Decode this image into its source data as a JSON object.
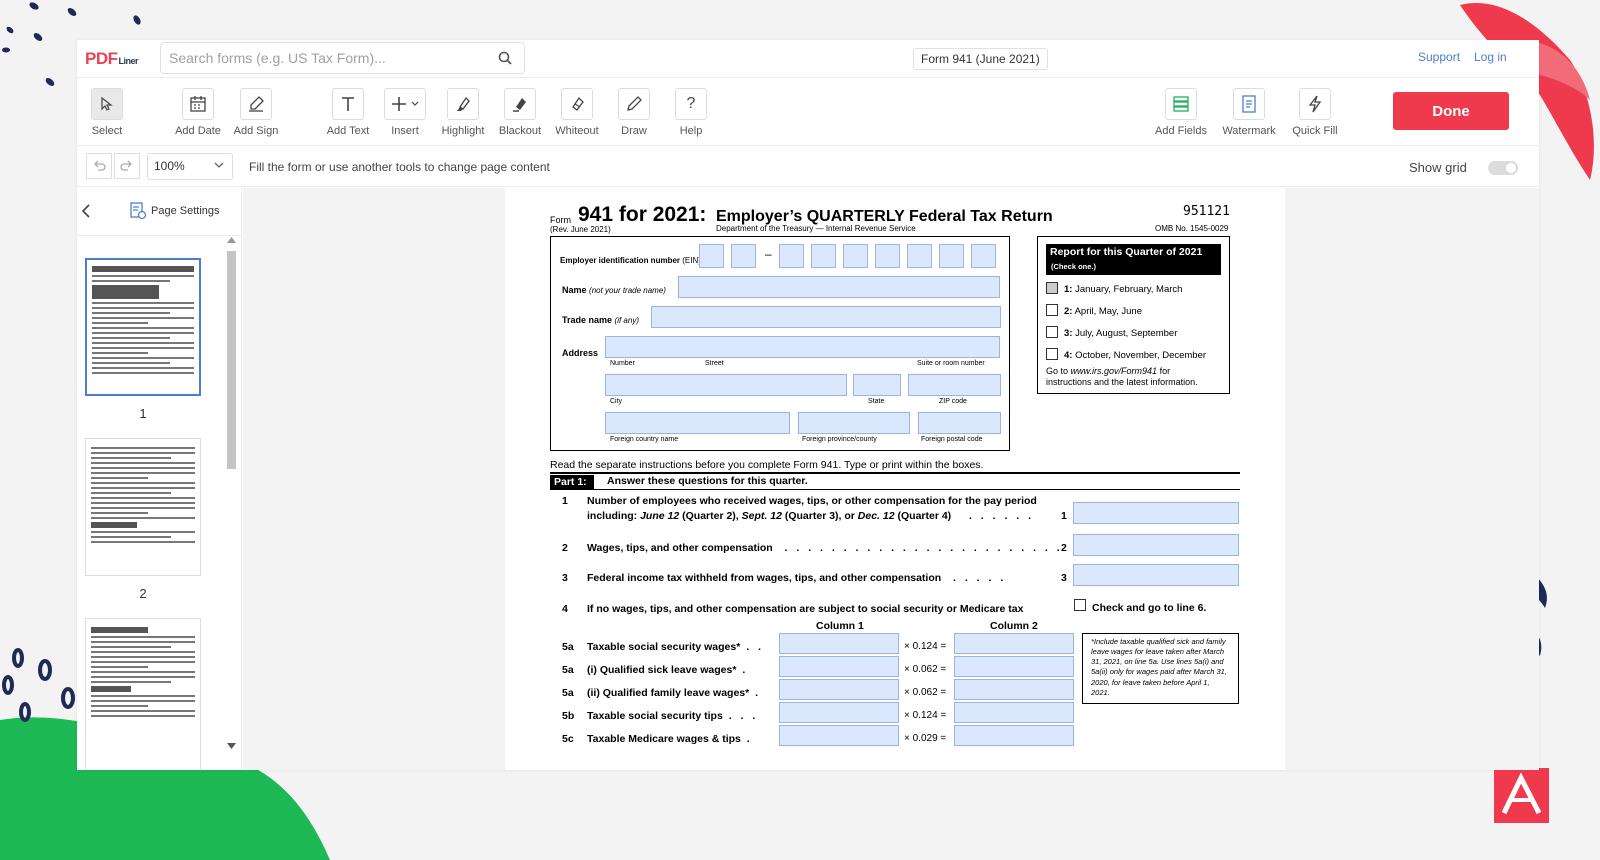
{
  "brand": {
    "logo_main": "PDF",
    "logo_sub": "Liner"
  },
  "search": {
    "placeholder": "Search forms (e.g. US Tax Form)..."
  },
  "document": {
    "title": "Form 941 (June 2021)"
  },
  "top_links": {
    "support": "Support",
    "login": "Log in"
  },
  "tools": [
    {
      "label": "Select",
      "icon": "cursor-icon"
    },
    {
      "label": "Add Date",
      "icon": "calendar-icon"
    },
    {
      "label": "Add Sign",
      "icon": "signature-icon"
    },
    {
      "label": "Add Text",
      "icon": "text-icon"
    },
    {
      "label": "Insert",
      "icon": "plus-icon"
    },
    {
      "label": "Highlight",
      "icon": "highlighter-icon"
    },
    {
      "label": "Blackout",
      "icon": "blackout-icon"
    },
    {
      "label": "Whiteout",
      "icon": "eraser-icon"
    },
    {
      "label": "Draw",
      "icon": "pen-icon"
    },
    {
      "label": "Help",
      "icon": "help-icon"
    }
  ],
  "right_tools": [
    {
      "label": "Add Fields",
      "icon": "fields-icon"
    },
    {
      "label": "Watermark",
      "icon": "watermark-icon"
    },
    {
      "label": "Quick Fill",
      "icon": "lightning-icon"
    }
  ],
  "done_label": "Done",
  "subbar": {
    "zoom": "100%",
    "hint": "Fill the form or use another tools to change page content",
    "show_grid": "Show grid",
    "show_grid_on": false
  },
  "sidebar": {
    "page_settings": "Page Settings",
    "pages": [
      "1",
      "2"
    ]
  },
  "form": {
    "form_word": "Form",
    "title_number": "941 for 2021:",
    "title_text": "Employer’s QUARTERLY Federal Tax Return",
    "rev": "(Rev. June 2021)",
    "dept": "Department of the Treasury — Internal Revenue Service",
    "code": "951121",
    "omb": "OMB No. 1545-0029",
    "ein_label": "Employer identification number",
    "ein_suffix": "(EIN)",
    "name_label": "Name",
    "name_hint": "(not your trade name)",
    "trade_label": "Trade name",
    "trade_hint": "(if any)",
    "address_label": "Address",
    "sub_number": "Number",
    "sub_street": "Street",
    "sub_suite": "Suite or room number",
    "sub_city": "City",
    "sub_state": "State",
    "sub_zip": "ZIP code",
    "sub_country": "Foreign country name",
    "sub_province": "Foreign province/county",
    "sub_postal": "Foreign postal code",
    "quarter_title": "Report for this Quarter of 2021",
    "quarter_sub": "(Check one.)",
    "quarters": [
      {
        "num": "1:",
        "text": "January, February, March",
        "checked": true
      },
      {
        "num": "2:",
        "text": "April, May, June",
        "checked": false
      },
      {
        "num": "3:",
        "text": "July, August, September",
        "checked": false
      },
      {
        "num": "4:",
        "text": "October, November, December",
        "checked": false
      }
    ],
    "goto_line1": "Go to",
    "goto_url": "www.irs.gov/Form941",
    "goto_for": "for",
    "goto_line2": "instructions and the latest information.",
    "read_instructions": "Read the separate instructions before you complete Form 941. Type or print within the boxes.",
    "part1_tag": "Part 1:",
    "part1_text": "Answer these questions for this quarter.",
    "line1_num": "1",
    "line1_text_a": "Number of employees who received wages, tips, or other compensation for the pay period",
    "line1_text_b_pre": "including:",
    "line1_text_b_i1": "June 12",
    "line1_text_b_m1": "(Quarter 2),",
    "line1_text_b_i2": "Sept. 12",
    "line1_text_b_m2": "(Quarter 3), or",
    "line1_text_b_i3": "Dec. 12",
    "line1_text_b_m3": "(Quarter 4)",
    "line1_box": "1",
    "line2_num": "2",
    "line2_text": "Wages, tips, and other compensation",
    "line2_box": "2",
    "line3_num": "3",
    "line3_text": "Federal income tax withheld from wages, tips, and other compensation",
    "line3_box": "3",
    "line4_num": "4",
    "line4_text": "If no wages, tips, and other compensation are subject to social security or Medicare tax",
    "line4_check": "Check and go to line 6.",
    "col1": "Column 1",
    "col2": "Column 2",
    "rows5": [
      {
        "num": "5a",
        "text": "Taxable social security wages*",
        "rate": "× 0.124 ="
      },
      {
        "num": "5a",
        "text": "(i)   Qualified sick leave wages*",
        "rate": "× 0.062 ="
      },
      {
        "num": "5a",
        "text": "(ii)  Qualified family leave wages*",
        "rate": "× 0.062 ="
      },
      {
        "num": "5b",
        "text": "Taxable social security tips",
        "rate": "× 0.124 ="
      },
      {
        "num": "5c",
        "text": "Taxable Medicare wages & tips",
        "rate": "× 0.029 ="
      }
    ],
    "note": "*Include taxable qualified sick and family leave wages for leave taken after March 31, 2021, on line 5a. Use lines 5a(i) and 5a(ii) only for wages paid after March 31, 2020, for leave taken before April 1, 2021."
  },
  "colors": {
    "accent": "#ef3a4d",
    "link": "#4a7fd0",
    "field_fill": "#dbe7fd",
    "deco_green": "#1db954",
    "deco_navy": "#1f2a55"
  }
}
